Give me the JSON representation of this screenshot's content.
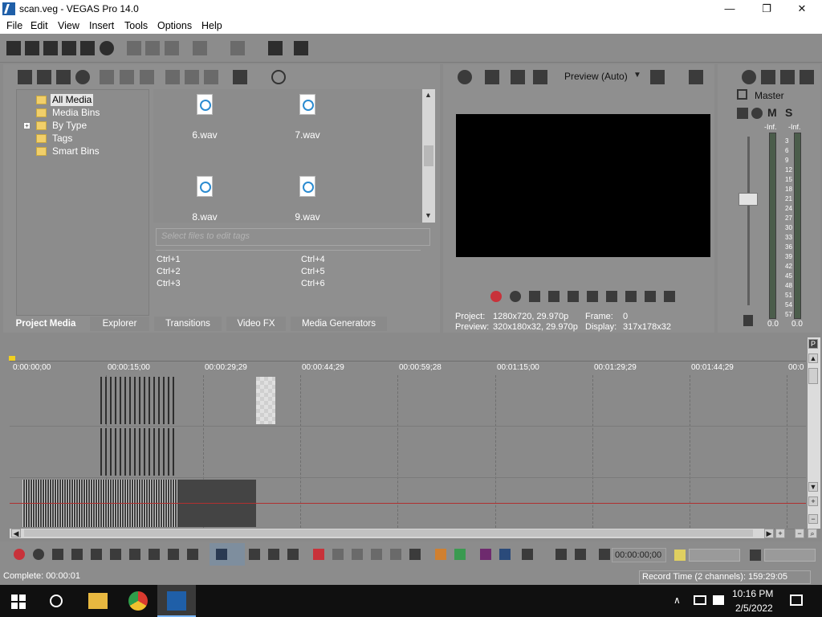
{
  "window": {
    "title": "scan.veg - VEGAS Pro 14.0",
    "minimize": "—",
    "maximize": "❐",
    "close": "✕"
  },
  "menu": [
    "File",
    "Edit",
    "View",
    "Insert",
    "Tools",
    "Options",
    "Help"
  ],
  "project_media": {
    "tree": [
      "All Media",
      "Media Bins",
      "By Type",
      "Tags",
      "Smart Bins"
    ],
    "files": [
      "6.wav",
      "7.wav",
      "8.wav",
      "9.wav"
    ],
    "tag_placeholder": "Select files to edit tags",
    "hotkeys": [
      "Ctrl+1",
      "Ctrl+2",
      "Ctrl+3",
      "Ctrl+4",
      "Ctrl+5",
      "Ctrl+6"
    ],
    "tabs": [
      "Project Media",
      "Explorer",
      "Transitions",
      "Video FX",
      "Media Generators"
    ]
  },
  "preview": {
    "mode": "Preview (Auto)",
    "project_label": "Project:",
    "project_value": "1280x720, 29.970p",
    "preview_label": "Preview:",
    "preview_value": "320x180x32, 29.970p",
    "frame_label": "Frame:",
    "frame_value": "0",
    "display_label": "Display:",
    "display_value": "317x178x32"
  },
  "mixer": {
    "title": "Master",
    "mute": "M",
    "solo": "S",
    "inf_left": "-Inf.",
    "inf_right": "-Inf.",
    "scale": [
      "3",
      "6",
      "9",
      "12",
      "15",
      "18",
      "21",
      "24",
      "27",
      "30",
      "33",
      "36",
      "39",
      "42",
      "45",
      "48",
      "51",
      "54",
      "57"
    ],
    "level_left": "0.0",
    "level_right": "0.0"
  },
  "timeline": {
    "ruler": [
      "0:00:00;00",
      "00:00:15;00",
      "00:00:29;29",
      "00:00:44;29",
      "00:00:59;28",
      "00:01:15;00",
      "00:01:29;29",
      "00:01:44;29",
      "00:0"
    ]
  },
  "transport": {
    "timecode": "00:00:00;00"
  },
  "status": {
    "left": "Complete: 00:00:01",
    "right": "Record Time (2 channels): 159:29:05"
  },
  "taskbar": {
    "time": "10:16 PM",
    "date": "2/5/2022"
  }
}
